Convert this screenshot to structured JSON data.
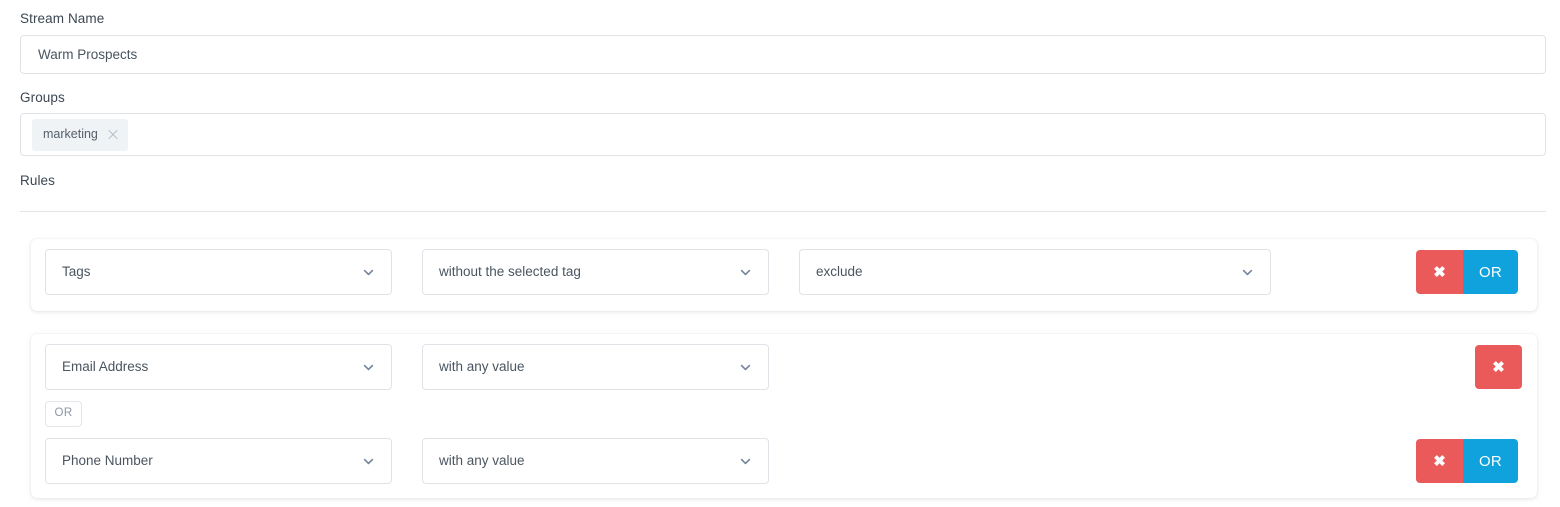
{
  "form": {
    "stream_name": {
      "label": "Stream Name",
      "value": "Warm Prospects",
      "placeholder": "Stream Name"
    },
    "groups": {
      "label": "Groups",
      "placeholder": "Groups",
      "tags": [
        {
          "label": "marketing",
          "remove_icon": "close-icon"
        }
      ]
    },
    "rules": {
      "label": "Rules"
    }
  },
  "icons": {
    "chevron_down": "chevron-down-icon",
    "delete": "close-icon"
  },
  "colors": {
    "delete_button": "#ea5a5a",
    "or_button": "#0fa2dc",
    "border": "#dfe3e8",
    "text": "#4a5560",
    "chip_background": "#f0f3f6"
  },
  "rule_groups": [
    {
      "id": "rule-group-1",
      "rows": [
        {
          "field": {
            "value": "Tags"
          },
          "operator": {
            "value": "without the selected tag"
          },
          "value": {
            "value": "exclude"
          },
          "delete_label": "✖",
          "or_label": "OR",
          "has_or_button": true,
          "has_value_select": true
        }
      ]
    },
    {
      "id": "rule-group-2",
      "joiner": "OR",
      "rows": [
        {
          "field": {
            "value": "Email Address"
          },
          "operator": {
            "value": "with any value"
          },
          "delete_label": "✖",
          "or_label": "OR",
          "has_or_button": false,
          "has_value_select": false
        },
        {
          "field": {
            "value": "Phone Number"
          },
          "operator": {
            "value": "with any value"
          },
          "delete_label": "✖",
          "or_label": "OR",
          "has_or_button": true,
          "has_value_select": false
        }
      ]
    }
  ]
}
